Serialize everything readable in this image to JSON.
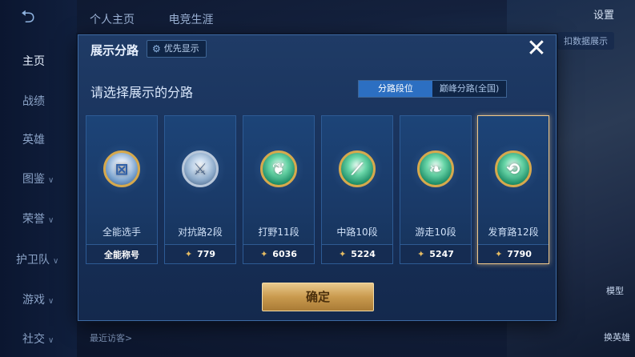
{
  "background": {
    "back_label": "⮌",
    "top_tabs": [
      "个人主页",
      "电竞生涯"
    ],
    "settings_label": "设置",
    "top_right_btn": "扣数据展示",
    "rail_items": [
      {
        "label": "主页",
        "has_caret": false
      },
      {
        "label": "战绩",
        "has_caret": false
      },
      {
        "label": "英雄",
        "has_caret": false
      },
      {
        "label": "图鉴",
        "has_caret": true
      },
      {
        "label": "荣誉",
        "has_caret": true
      },
      {
        "label": "护卫队",
        "has_caret": true
      },
      {
        "label": "游戏",
        "has_caret": true
      },
      {
        "label": "社交",
        "has_caret": true
      }
    ],
    "recent_visitor": "最近访客>",
    "model_label": "模型",
    "swap_hero_label": "换英雄"
  },
  "dialog": {
    "title": "展示分路",
    "priority_label": "优先显示",
    "close_label": "✕",
    "subtitle": "请选择展示的分路",
    "segment": {
      "options": [
        "分路段位",
        "巅峰分路(全国)"
      ],
      "selected_index": 0
    },
    "cards": [
      {
        "name": "全能选手",
        "foot_text": "全能称号",
        "has_points": false,
        "badge": "gold-blue",
        "glyph": "⊠",
        "selected": false
      },
      {
        "name": "对抗路2段",
        "foot_text": "779",
        "has_points": true,
        "badge": "silver",
        "glyph": "⚔",
        "selected": false
      },
      {
        "name": "打野11段",
        "foot_text": "6036",
        "has_points": true,
        "badge": "green",
        "glyph": "❦",
        "selected": false
      },
      {
        "name": "中路10段",
        "foot_text": "5224",
        "has_points": true,
        "badge": "green",
        "glyph": "⟋",
        "selected": false
      },
      {
        "name": "游走10段",
        "foot_text": "5247",
        "has_points": true,
        "badge": "green",
        "glyph": "❧",
        "selected": false
      },
      {
        "name": "发育路12段",
        "foot_text": "7790",
        "has_points": true,
        "badge": "green",
        "glyph": "⟲",
        "selected": true
      }
    ],
    "confirm_label": "确定"
  },
  "colors": {
    "accent_blue": "#2c6fc2",
    "gold": "#d6a94d",
    "selected_border": "#f0c98b"
  }
}
